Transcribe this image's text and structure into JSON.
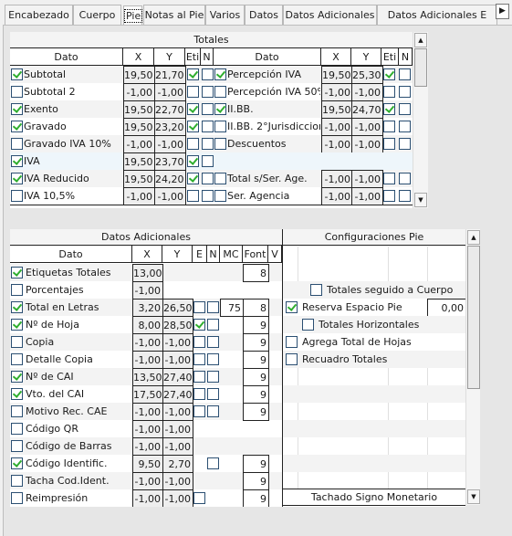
{
  "tabs": [
    "Encabezado",
    "Cuerpo",
    "Pie",
    "Notas al Pie",
    "Varios",
    "Datos",
    "Datos Adicionales",
    "Datos Adicionales E"
  ],
  "selected_tab": "Pie",
  "totales": {
    "title": "Totales",
    "headers": [
      "Dato",
      "X",
      "Y",
      "Eti",
      "N",
      "Dato",
      "X",
      "Y",
      "Eti",
      "N"
    ],
    "left": [
      {
        "checked": true,
        "label": "Subtotal",
        "x": "19,50",
        "y": "21,70",
        "eti": true,
        "n": false
      },
      {
        "checked": false,
        "label": "Subtotal 2",
        "x": "-1,00",
        "y": "-1,00",
        "eti": false,
        "n": false
      },
      {
        "checked": true,
        "label": "Exento",
        "x": "19,50",
        "y": "22,70",
        "eti": true,
        "n": false
      },
      {
        "checked": true,
        "label": "Gravado",
        "x": "19,50",
        "y": "23,20",
        "eti": true,
        "n": false
      },
      {
        "checked": false,
        "label": "Gravado IVA 10%",
        "x": "-1,00",
        "y": "-1,00",
        "eti": false,
        "n": false
      },
      {
        "checked": true,
        "label": "IVA",
        "x": "19,50",
        "y": "23,70",
        "eti": true,
        "n": false
      },
      {
        "checked": true,
        "label": "IVA Reducido",
        "x": "19,50",
        "y": "24,20",
        "eti": true,
        "n": false
      },
      {
        "checked": false,
        "label": "IVA 10,5%",
        "x": "-1,00",
        "y": "-1,00",
        "eti": false,
        "n": false
      }
    ],
    "right": [
      {
        "checked": true,
        "label": "Percepción IVA",
        "x": "19,50",
        "y": "25,30",
        "eti": true,
        "n": false
      },
      {
        "checked": false,
        "label": "Percepción IVA 50%",
        "x": "-1,00",
        "y": "-1,00",
        "eti": false,
        "n": false
      },
      {
        "checked": true,
        "label": "II.BB.",
        "x": "19,50",
        "y": "24,70",
        "eti": true,
        "n": false
      },
      {
        "checked": false,
        "label": "II.BB. 2°Jurisdiccion",
        "x": "-1,00",
        "y": "-1,00",
        "eti": false,
        "n": false
      },
      {
        "checked": false,
        "label": "Descuentos",
        "x": "-1,00",
        "y": "-1,00",
        "eti": false,
        "n": false
      },
      null,
      {
        "checked": false,
        "label": "Total s/Ser. Age.",
        "x": "-1,00",
        "y": "-1,00",
        "eti": false,
        "n": false
      },
      {
        "checked": false,
        "label": "Ser. Agencia",
        "x": "-1,00",
        "y": "-1,00",
        "eti": false,
        "n": false
      }
    ]
  },
  "adicionales": {
    "title": "Datos Adicionales",
    "headers": [
      "Dato",
      "X",
      "Y",
      "E",
      "N",
      "MC",
      "Font",
      "V"
    ],
    "rows": [
      {
        "checked": true,
        "label": "Etiquetas Totales",
        "x": "13,00",
        "font": "8"
      },
      {
        "checked": false,
        "label": "Porcentajes",
        "x": "-1,00"
      },
      {
        "checked": true,
        "label": "Total en Letras",
        "x": "3,20",
        "y": "26,50",
        "e": false,
        "n": false,
        "mc": "75",
        "font": "8"
      },
      {
        "checked": true,
        "label": "Nº de Hoja",
        "x": "8,00",
        "y": "28,50",
        "e": true,
        "n": false,
        "font": "9"
      },
      {
        "checked": false,
        "label": "Copia",
        "x": "-1,00",
        "y": "-1,00",
        "e": false,
        "n": false,
        "font": "9"
      },
      {
        "checked": false,
        "label": "Detalle Copia",
        "x": "-1,00",
        "y": "-1,00",
        "e": false,
        "n": false,
        "font": "9"
      },
      {
        "checked": true,
        "label": "Nº de CAI",
        "x": "13,50",
        "y": "27,40",
        "e": false,
        "n": false,
        "font": "9"
      },
      {
        "checked": true,
        "label": "Vto. del CAI",
        "x": "17,50",
        "y": "27,40",
        "e": false,
        "n": false,
        "font": "9"
      },
      {
        "checked": false,
        "label": "Motivo Rec. CAE",
        "x": "-1,00",
        "y": "-1,00",
        "e": false,
        "n": false,
        "font": "9"
      },
      {
        "checked": false,
        "label": "Código QR",
        "x": "-1,00",
        "y": "-1,00"
      },
      {
        "checked": false,
        "label": "Código de Barras",
        "x": "-1,00",
        "y": "-1,00"
      },
      {
        "checked": true,
        "label": "Código Identific.",
        "x": "9,50",
        "y": "2,70",
        "n": false,
        "font": "9"
      },
      {
        "checked": false,
        "label": "Tacha Cod.Ident.",
        "x": "-1,00",
        "y": "-1,00",
        "font": "9"
      },
      {
        "checked": false,
        "label": "Reimpresión",
        "x": "-1,00",
        "y": "-1,00",
        "e": false,
        "font": "9"
      }
    ]
  },
  "config": {
    "title": "Configuraciones Pie",
    "options": [
      {
        "row": 1,
        "indent": 2,
        "checked": false,
        "label": "Totales seguido a Cuerpo"
      },
      {
        "row": 2,
        "indent": 0,
        "checked": true,
        "label": "Reserva Espacio Pie",
        "value": "0,00"
      },
      {
        "row": 3,
        "indent": 1,
        "checked": false,
        "label": "Totales Horizontales"
      },
      {
        "row": 4,
        "indent": 0,
        "checked": false,
        "label": "Agrega Total de Hojas"
      },
      {
        "row": 5,
        "indent": 0,
        "checked": false,
        "label": "Recuadro Totales"
      }
    ],
    "footer": "Tachado Signo Monetario"
  }
}
